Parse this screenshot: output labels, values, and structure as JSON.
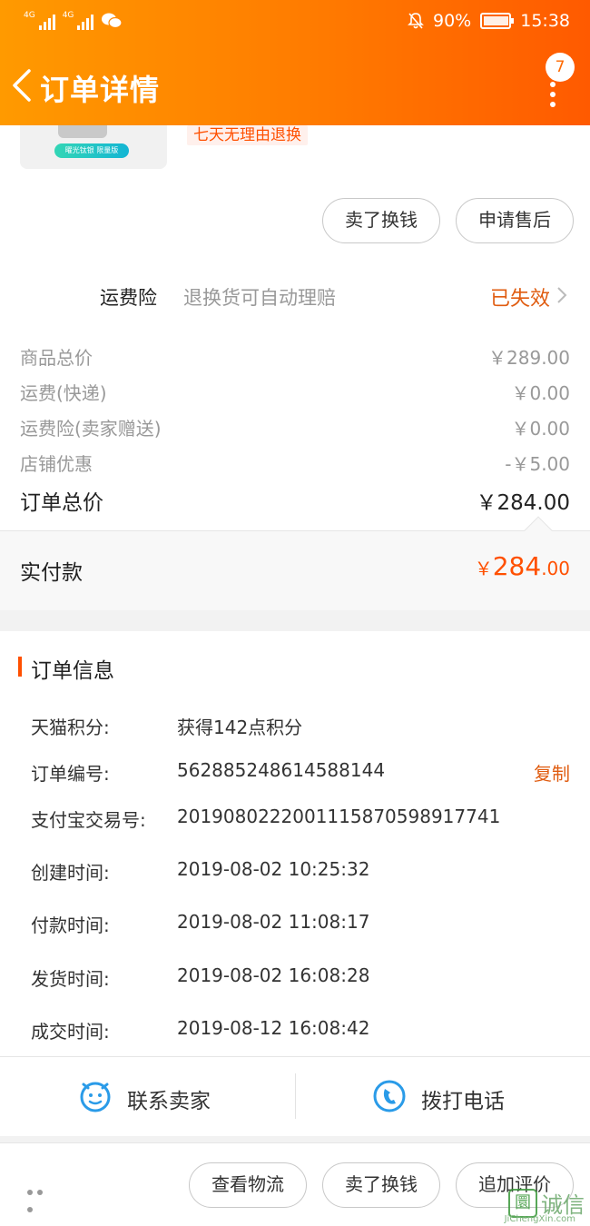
{
  "status_bar": {
    "signal1_tag": "4G",
    "signal2_tag": "4G",
    "battery": "90%",
    "time": "15:38"
  },
  "nav": {
    "title": "订单详情",
    "badge_count": "7"
  },
  "product": {
    "thumb_label": "曜光钛银 限量版",
    "tag": "七天无理由退换"
  },
  "top_actions": [
    "卖了换钱",
    "申请售后"
  ],
  "shipping_insurance": {
    "label": "运费险",
    "desc": "退换货可自动理赔",
    "state": "已失效"
  },
  "price_breakdown": [
    {
      "label": "商品总价",
      "value": "￥289.00"
    },
    {
      "label": "运费(快递)",
      "value": "￥0.00"
    },
    {
      "label": "运费险(卖家赠送)",
      "value": "￥0.00"
    },
    {
      "label": "店铺优惠",
      "value": "-￥5.00"
    }
  ],
  "order_total": {
    "label": "订单总价",
    "value": "￥284.00"
  },
  "paid": {
    "label": "实付款",
    "currency": "￥",
    "integer": "284",
    "decimal": ".00"
  },
  "order_info": {
    "heading": "订单信息",
    "rows": [
      {
        "label": "天猫积分:",
        "value": "获得142点积分"
      },
      {
        "label": "订单编号:",
        "value": "562885248614588144",
        "action": "复制"
      },
      {
        "label": "支付宝交易号:",
        "value": "2019080222001115870598917741"
      },
      {
        "label": "创建时间:",
        "value": "2019-08-02 10:25:32"
      },
      {
        "label": "付款时间:",
        "value": "2019-08-02 11:08:17"
      },
      {
        "label": "发货时间:",
        "value": "2019-08-02 16:08:28"
      },
      {
        "label": "成交时间:",
        "value": "2019-08-12 16:08:42"
      }
    ]
  },
  "contact": {
    "seller": "联系卖家",
    "call": "拨打电话"
  },
  "bottom_actions": [
    "查看物流",
    "卖了换钱",
    "追加评价"
  ],
  "watermark": {
    "cn": "诚信",
    "en": "JiChengXin.com",
    "mark": "圜"
  },
  "colors": {
    "header_start": "#ff9a00",
    "header_end": "#ff5a00",
    "accent": "#ff5000",
    "state_orange": "#e05c10",
    "contact_icon": "#2a9be8"
  },
  "icons": [
    "back-arrow-icon",
    "more-dots-icon",
    "chevron-right-icon",
    "chat-face-icon",
    "phone-icon",
    "mute-bell-icon",
    "wechat-icon",
    "battery-icon"
  ]
}
